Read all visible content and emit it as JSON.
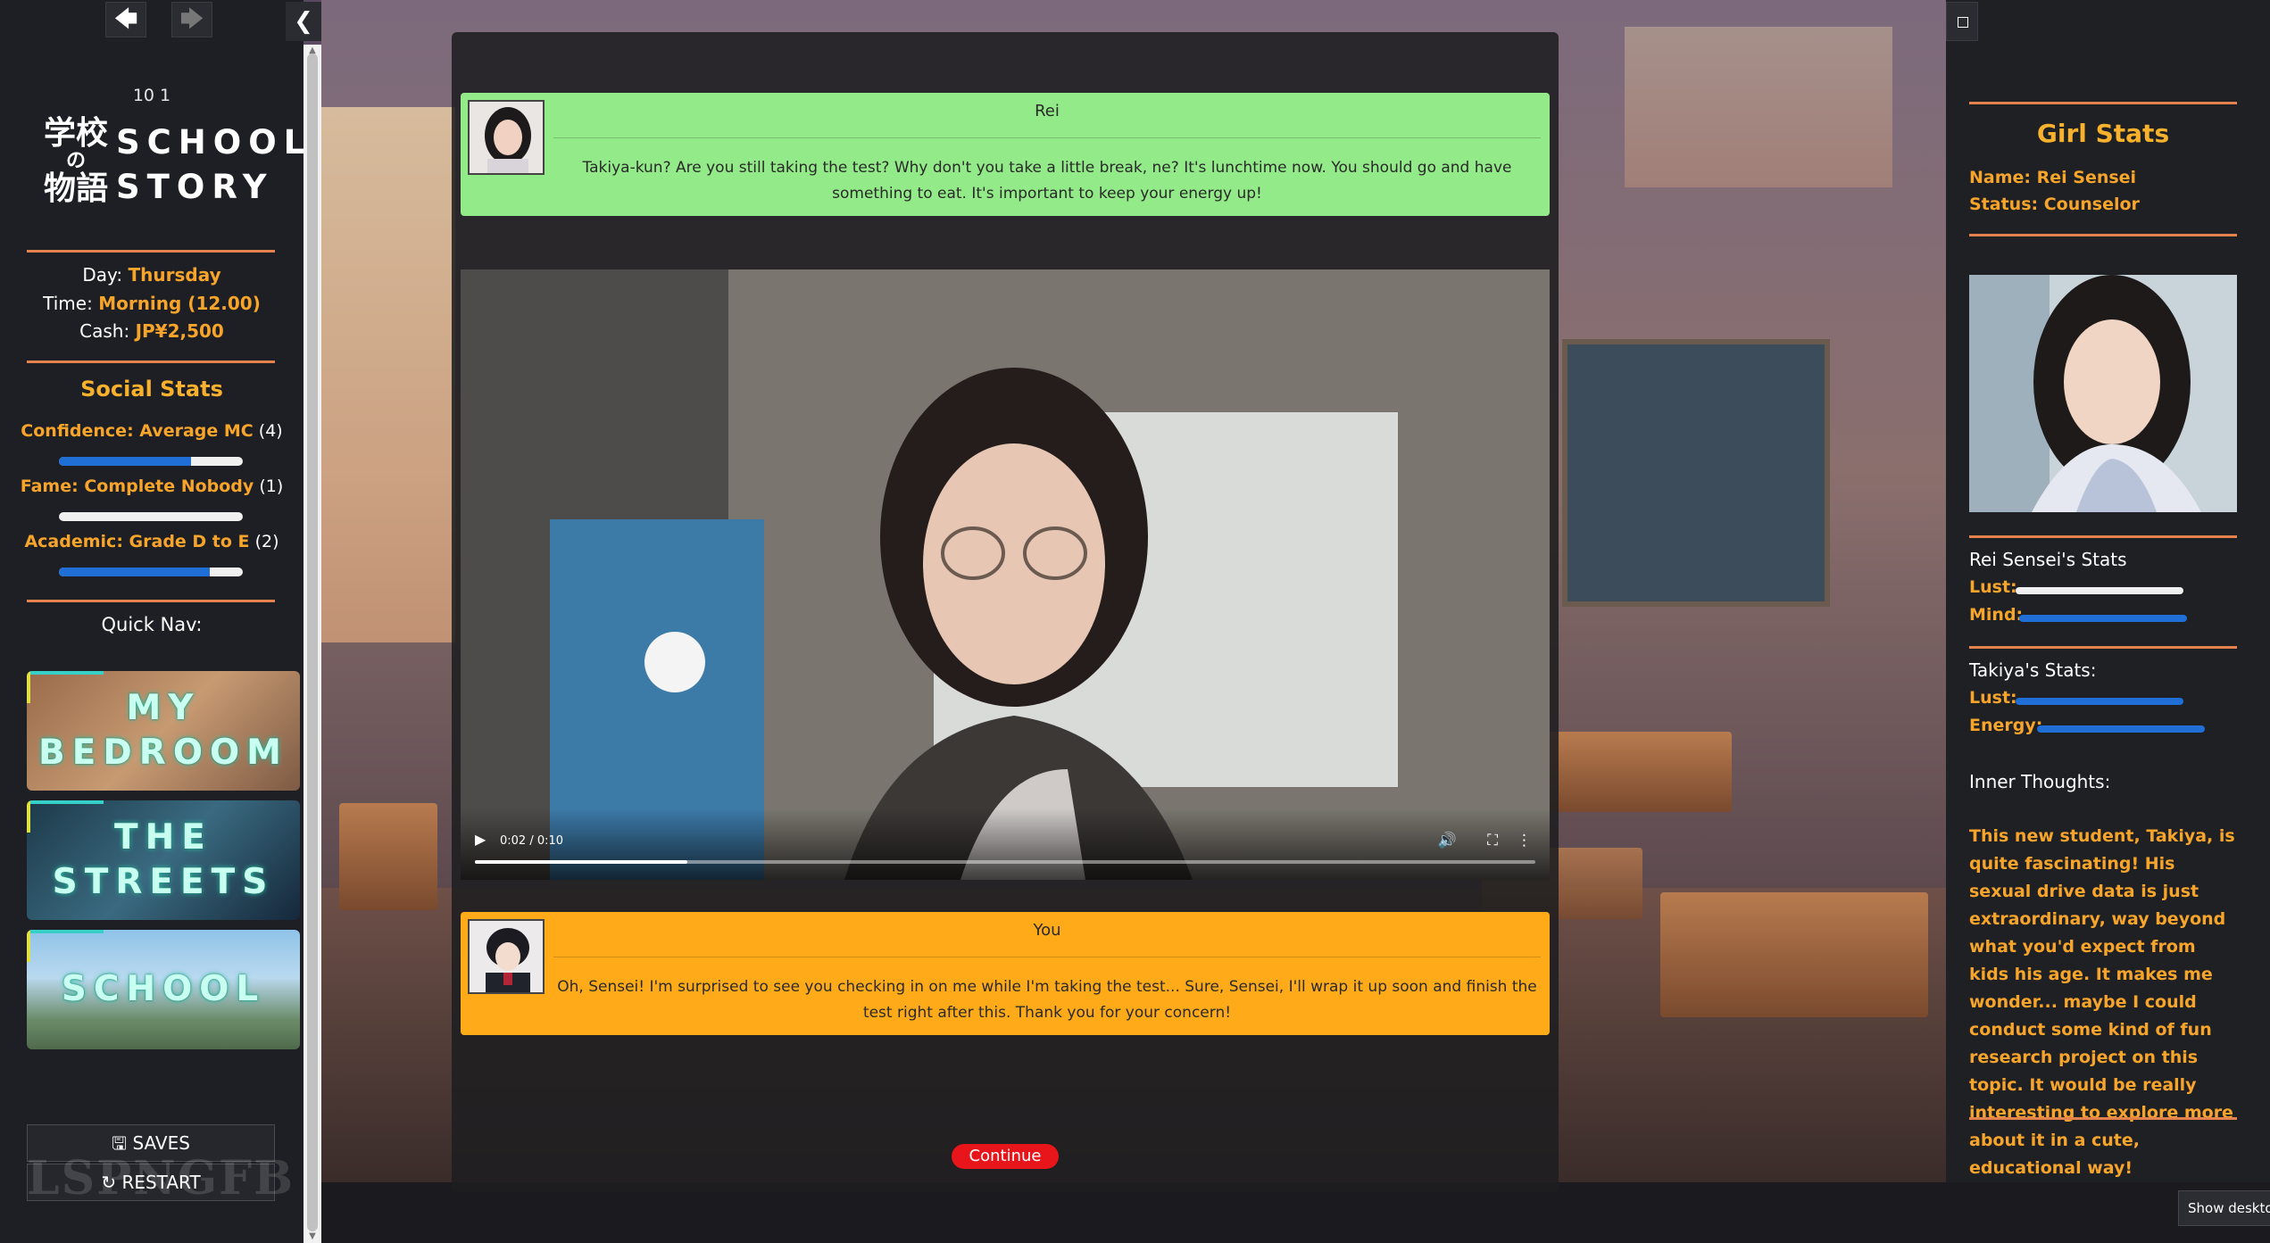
{
  "app": {
    "version": "10 1"
  },
  "logo": {
    "kanji_top": "学校",
    "kanji_mid": "の",
    "kanji_bottom": "物語",
    "word1": "SCHOOL",
    "word2": "STORY"
  },
  "status": {
    "day_label": "Day:",
    "day_value": "Thursday",
    "time_label": "Time:",
    "time_value": "Morning (12.00)",
    "cash_label": "Cash:",
    "cash_value": "JP¥2,500"
  },
  "social_stats": {
    "title": "Social Stats",
    "items": [
      {
        "name": "Confidence: Average MC",
        "level": "(4)",
        "fill": 0.72
      },
      {
        "name": "Fame: Complete Nobody",
        "level": "(1)",
        "fill": 0.0
      },
      {
        "name": "Academic: Grade D to E",
        "level": "(2)",
        "fill": 0.82
      }
    ]
  },
  "quick_nav": {
    "label": "Quick Nav:",
    "cards": [
      {
        "line1": "MY",
        "line2": "BEDROOM"
      },
      {
        "line1": "THE",
        "line2": "STREETS"
      },
      {
        "line1": "SCHOOL",
        "line2": ""
      }
    ]
  },
  "buttons": {
    "saves": "SAVES",
    "restart": "RESTART"
  },
  "watermark": "LSPNGFB",
  "dialog_rei": {
    "speaker": "Rei",
    "text": "Takiya-kun? Are you still taking the test? Why don't you take a little break, ne? It's lunchtime now. You should go and have something to eat. It's important to keep your energy up!"
  },
  "video": {
    "time": "0:02 / 0:10",
    "progress": 0.2
  },
  "dialog_you": {
    "speaker": "You",
    "text": "Oh, Sensei! I'm surprised to see you checking in on me while I'm taking the test... Sure, Sensei, I'll wrap it up soon and finish the test right after this. Thank you for your concern!"
  },
  "continue_label": "Continue",
  "girl_stats": {
    "title": "Girl Stats",
    "name": "Name: Rei Sensei",
    "status": "Status: Counselor",
    "girl_heading": "Rei Sensei's Stats",
    "girl_stats": [
      {
        "label": "Lust:",
        "fill": 0.0,
        "color": "#f0f0f0"
      },
      {
        "label": "Mind:",
        "fill": 1.0,
        "color": "#1f6fd6"
      }
    ],
    "player_heading": "Takiya's Stats:",
    "player_stats": [
      {
        "label": "Lust:",
        "fill": 1.0,
        "color": "#1f6fd6"
      },
      {
        "label": "Energy:",
        "fill": 1.0,
        "color": "#1f6fd6"
      }
    ],
    "thoughts_heading": "Inner Thoughts:",
    "thoughts": "This new student, Takiya, is quite fascinating! His sexual drive data is just extraordinary, way beyond what you'd expect from kids his age. It makes me wonder... maybe I could conduct some kind of fun research project on this topic. It would be really interesting to explore more about it in a cute, educational way!"
  },
  "show_desktop": "Show desktop",
  "icons": [
    "arrow-left-icon",
    "arrow-right-icon",
    "chevron-left-icon",
    "save-icon",
    "restart-icon",
    "play-icon",
    "volume-icon",
    "fullscreen-icon",
    "more-icon",
    "panel-toggle-icon"
  ]
}
